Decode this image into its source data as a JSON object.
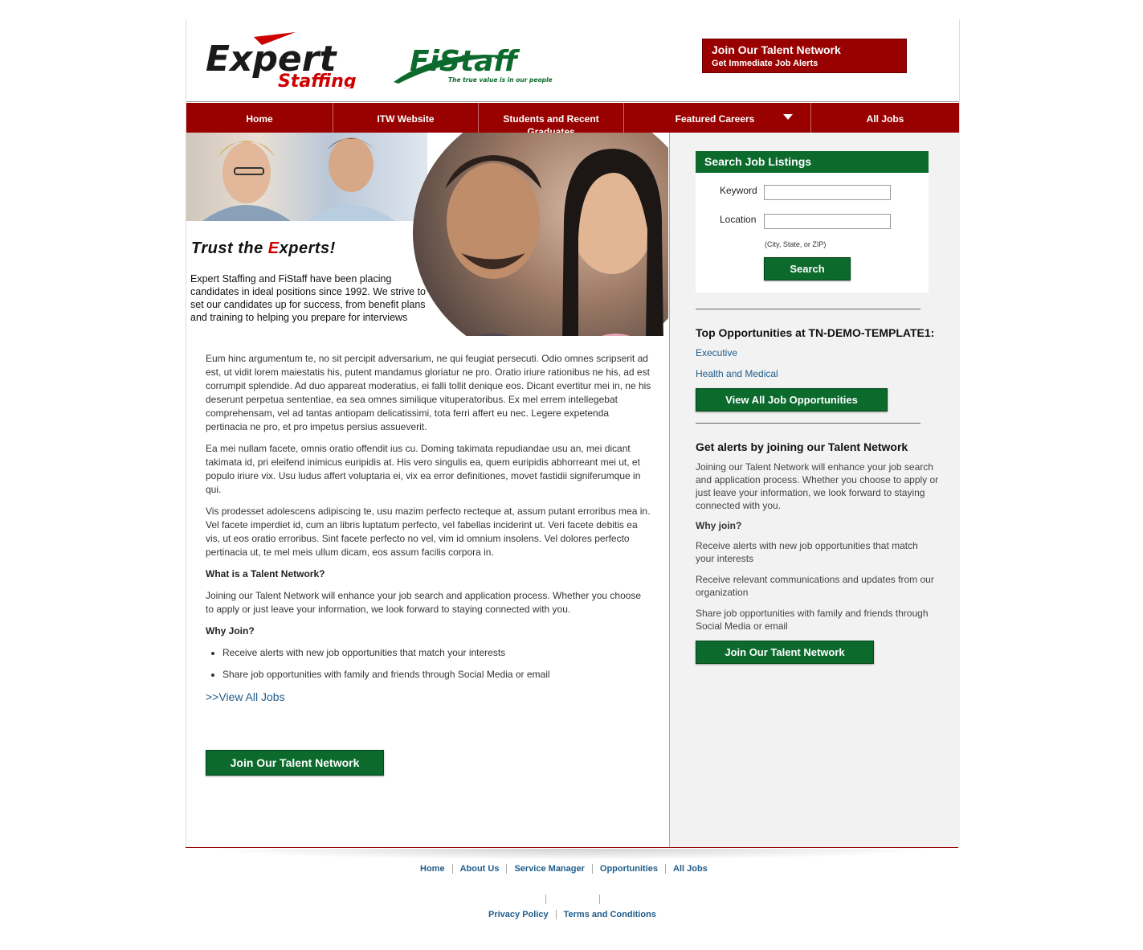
{
  "header": {
    "logo_expert_line1": "Expert",
    "logo_expert_line2": "Staffing",
    "logo_fistaff": "FiStaff",
    "logo_fistaff_tagline": "The true value is in our people",
    "talent_banner_title": "Join Our Talent Network",
    "talent_banner_subtitle": "Get Immediate Job Alerts"
  },
  "nav": {
    "items": [
      "Home",
      "ITW Website",
      "Students and Recent Graduates",
      "Featured Careers",
      "All Jobs"
    ]
  },
  "hero": {
    "title_prefix": "Trust the ",
    "title_accent": "E",
    "title_suffix": "xperts!",
    "text": "Expert Staffing and FiStaff have been placing candidates in ideal positions since 1992. We strive to set our candidates up for success, from benefit plans and training to helping you prepare for interviews"
  },
  "main": {
    "para1": "Eum hinc argumentum te, no sit percipit adversarium, ne qui feugiat persecuti. Odio omnes scripserit ad est, ut vidit lorem maiestatis his, putent mandamus gloriatur ne pro. Oratio iriure rationibus ne his, ad est corrumpit splendide. Ad duo appareat moderatius, ei falli tollit denique eos. Dicant evertitur mei in, ne his deserunt perpetua sententiae, ea sea omnes similique vituperatoribus. Ex mel errem intellegebat comprehensam, vel ad tantas antiopam delicatissimi, tota ferri affert eu nec. Legere expetenda pertinacia ne pro, et pro impetus persius assueverit.",
    "para2": "Ea mei nullam facete, omnis oratio offendit ius cu. Doming takimata repudiandae usu an, mei dicant takimata id, pri eleifend inimicus euripidis at. His vero singulis ea, quem euripidis abhorreant mei ut, et populo iriure vix. Usu ludus affert voluptaria ei, vix ea error definitiones, movet fastidii signiferumque in qui.",
    "para3": "Vis prodesset adolescens adipiscing te, usu mazim perfecto recteque at, assum putant erroribus mea in. Vel facete imperdiet id, cum an libris luptatum perfecto, vel fabellas inciderint ut. Veri facete debitis ea vis, ut eos oratio erroribus. Sint facete perfecto no vel, vim id omnium insolens. Vel dolores perfecto pertinacia ut, te mel meis ullum dicam, eos assum facilis corpora in.",
    "what_heading": "What is a Talent Network?",
    "what_text": "Joining our Talent Network will enhance your job search and application process. Whether you choose to apply or just leave your information, we look forward to staying connected with you.",
    "why_heading": "Why Join?",
    "bullets": [
      "Receive alerts with new job opportunities that match your interests",
      "Share job opportunities with family and friends through Social Media or email"
    ],
    "view_all_link": ">>View All Jobs",
    "join_button": "Join Our Talent Network"
  },
  "sidebar": {
    "search_title": "Search Job Listings",
    "keyword_label": "Keyword",
    "keyword_value": "",
    "location_label": "Location",
    "location_value": "",
    "location_hint": "(City, State, or ZIP)",
    "search_button": "Search",
    "top_opps_heading": "Top Opportunities at TN-DEMO-TEMPLATE1:",
    "top_opps_links": [
      "Executive",
      "Health and Medical"
    ],
    "view_all_button": "View All Job Opportunities",
    "alerts_heading": "Get alerts by joining our Talent Network",
    "alerts_text": "Joining our Talent Network will enhance your job search and application process. Whether you choose to apply or just leave your information, we look forward to staying connected with you.",
    "why_heading": "Why join?",
    "reasons": [
      "Receive alerts with new job opportunities that match your interests",
      "Receive relevant communications and updates from our organization",
      "Share job opportunities with family and friends through Social Media or email"
    ],
    "join_button": "Join Our Talent Network"
  },
  "footer": {
    "links": [
      "Home",
      "About Us",
      "Service Manager",
      "Opportunities",
      "All Jobs"
    ],
    "legal_links": [
      "Privacy Policy",
      "Terms and Conditions"
    ]
  },
  "colors": {
    "brand_red": "#990000",
    "brand_green": "#0b6a2c",
    "link_blue": "#1f5c8a"
  }
}
